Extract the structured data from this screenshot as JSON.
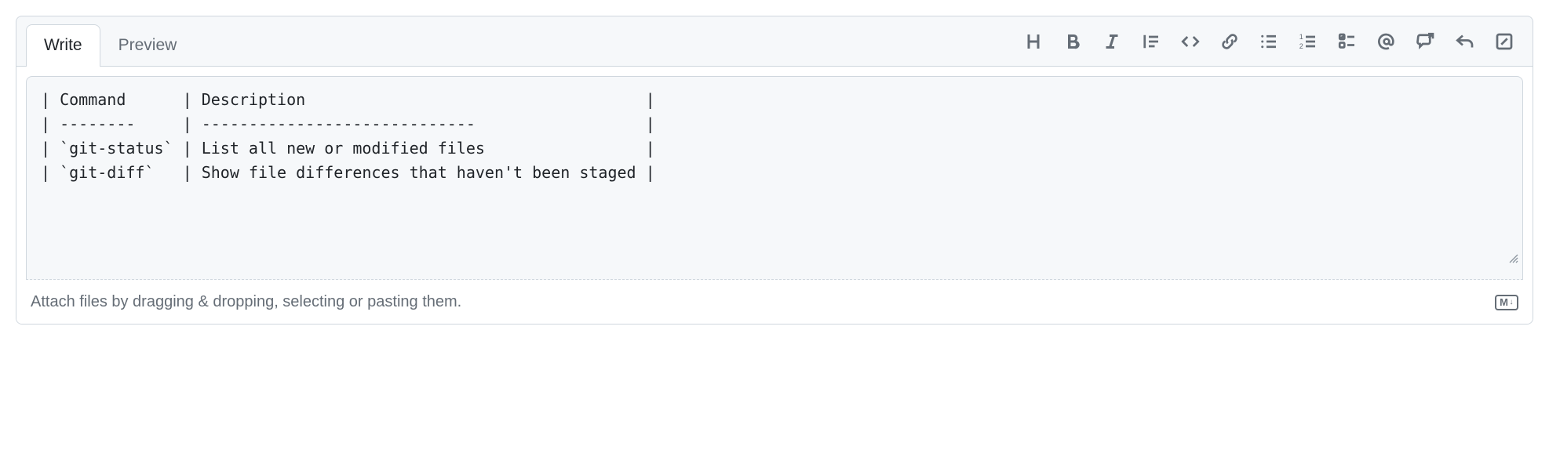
{
  "tabs": {
    "write": "Write",
    "preview": "Preview"
  },
  "toolbar": {
    "heading": "Heading",
    "bold": "Bold",
    "italic": "Italic",
    "quote": "Quote",
    "code": "Code",
    "link": "Link",
    "ul": "Unordered list",
    "ol": "Ordered list",
    "tasklist": "Task list",
    "mention": "Mention",
    "reference": "Reference",
    "reply": "Reply",
    "fullscreen": "Full screen"
  },
  "content": "| Command      | Description                                    |\n| --------     | -----------------------------                  |\n| `git-status` | List all new or modified files                 |\n| `git-diff`   | Show file differences that haven't been staged |",
  "footer": {
    "attach_hint": "Attach files by dragging & dropping, selecting or pasting them.",
    "markdown_label": "M"
  }
}
